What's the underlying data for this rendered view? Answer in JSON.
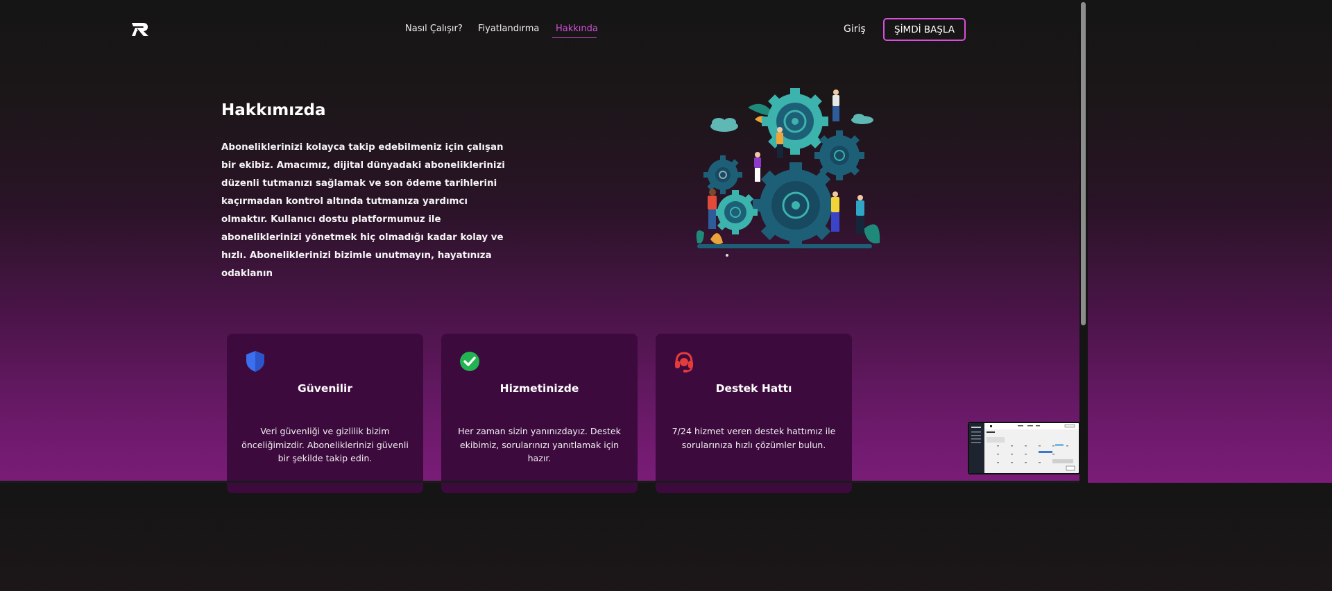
{
  "nav": {
    "logo_icon": "r-logo-icon",
    "links": [
      "Nasıl Çalışır?",
      "Fiyatlandırma",
      "Hakkında"
    ],
    "active_link": "Hakkında",
    "login_label": "Giriş",
    "cta_label": "ŞİMDİ BAŞLA"
  },
  "hero": {
    "title": "Hakkımızda",
    "text": "Aboneliklerinizi kolayca takip edebilmeniz için çalışan bir ekibiz. Amacımız, dijital dünyadaki aboneliklerinizi düzenli tutmanızı sağlamak ve son ödeme tarihlerini kaçırmadan kontrol altında tutmanıza yardımcı olmaktır. Kullanıcı dostu platformumuz ile aboneliklerinizi yönetmek hiç olmadığı kadar kolay ve hızlı. Aboneliklerinizi bizimle unutmayın, hayatınıza odaklanın",
    "illustration_icon": "team-gears-illustration"
  },
  "features": [
    {
      "icon": "shield-icon",
      "title": "Güvenilir",
      "text": "Veri güvenliği ve gizlilik bizim önceliğimizdir. Aboneliklerinizi güvenli bir şekilde takip edin."
    },
    {
      "icon": "check-circle-icon",
      "title": "Hizmetinizde",
      "text": "Her zaman sizin yanınızdayız. Destek ekibimiz, sorularınızı yanıtlamak için hazır."
    },
    {
      "icon": "headset-icon",
      "title": "Destek Hattı",
      "text": "7/24 hizmet veren destek hattımız ile sorularınıza hızlı çözümler bulun."
    }
  ],
  "colors": {
    "accent": "#d152d6",
    "card_bg": "#3d0a3e",
    "shield": "#3b6ff0",
    "check": "#22b452",
    "headset": "#e43b3b"
  }
}
